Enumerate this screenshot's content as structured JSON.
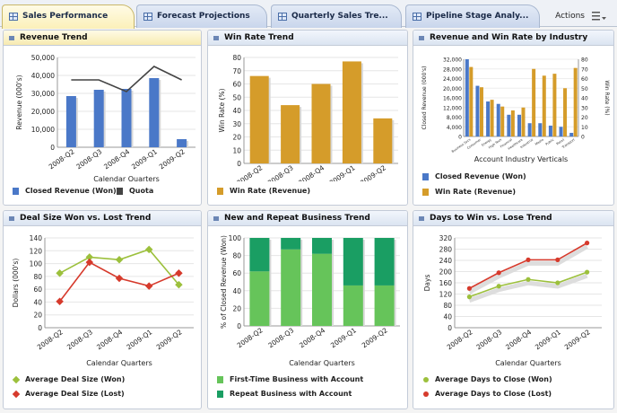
{
  "tabs": [
    {
      "label": "Sales Performance",
      "active": true
    },
    {
      "label": "Forecast Projections",
      "active": false
    },
    {
      "label": "Quarterly Sales Tre...",
      "active": false
    },
    {
      "label": "Pipeline Stage Analy...",
      "active": false
    }
  ],
  "toolbar": {
    "actions_label": "Actions"
  },
  "colors": {
    "blue": "#4a78c8",
    "gold": "#d59c2a",
    "dark": "#444444",
    "olive": "#9cc03c",
    "red": "#d63a2c",
    "green_light": "#66c45a",
    "green_dark": "#1a9e63"
  },
  "panels": {
    "revenue_trend": {
      "title": "Revenue Trend",
      "legend": [
        "Closed Revenue (Won)",
        "Quota"
      ],
      "chart_data": {
        "type": "bar",
        "categories": [
          "2008-Q2",
          "2008-Q3",
          "2008-Q4",
          "2009-Q1",
          "2009-Q2"
        ],
        "series": [
          {
            "name": "Closed Revenue (Won)",
            "values": [
              28500,
              32000,
              32500,
              38500,
              4500
            ],
            "kind": "bar"
          },
          {
            "name": "Quota",
            "values": [
              37500,
              37500,
              31000,
              45000,
              37500
            ],
            "kind": "line"
          }
        ],
        "ylim": [
          0,
          50000
        ],
        "yticks": [
          "0",
          "10,000",
          "20,000",
          "30,000",
          "40,000",
          "50,000"
        ],
        "ylabel": "Revenue (000's)",
        "xlabel": "Calendar Quarters"
      }
    },
    "win_rate_trend": {
      "title": "Win Rate Trend",
      "legend": [
        "Win Rate (Revenue)"
      ],
      "chart_data": {
        "type": "bar",
        "categories": [
          "2008-Q2",
          "2008-Q3",
          "2008-Q4",
          "2009-Q1",
          "2009-Q2"
        ],
        "series": [
          {
            "name": "Win Rate (Revenue)",
            "values": [
              66,
              44,
              60,
              77,
              34
            ]
          }
        ],
        "ylim": [
          0,
          80
        ],
        "yticks": [
          "0",
          "10",
          "20",
          "30",
          "40",
          "50",
          "60",
          "70",
          "80"
        ],
        "ylabel": "Win Rate (%)",
        "xlabel": "Calendar Quarters"
      }
    },
    "revenue_win_industry": {
      "title": "Revenue and Win Rate by Industry",
      "legend": [
        "Closed Revenue (Won)",
        "Win Rate (Revenue)"
      ],
      "chart_data": {
        "type": "bar",
        "categories": [
          "Business Svcs",
          "Consumer",
          "Energy",
          "High Tech",
          "Financial",
          "Healthcare",
          "Industrial",
          "Media",
          "Public",
          "Retail",
          "Transport"
        ],
        "series": [
          {
            "name": "Closed Revenue (Won)",
            "values": [
              32000,
              21000,
              14500,
              13500,
              9000,
              9000,
              5500,
              5500,
              4500,
              4000,
              1500
            ],
            "axis": "left"
          },
          {
            "name": "Win Rate (Revenue)",
            "values": [
              72,
              51,
              38,
              31,
              27,
              30,
              70,
              63,
              65,
              50,
              71
            ],
            "axis": "right"
          }
        ],
        "ylim_left": [
          0,
          32000
        ],
        "yticks_left": [
          "0",
          "4,000",
          "8,000",
          "12,000",
          "16,000",
          "20,000",
          "24,000",
          "28,000",
          "32,000"
        ],
        "ylim_right": [
          0,
          80
        ],
        "yticks_right": [
          "0",
          "10",
          "20",
          "30",
          "40",
          "50",
          "60",
          "70",
          "80"
        ],
        "ylabel_left": "Closed Revenue (000's)",
        "ylabel_right": "Win Rate (%)",
        "xlabel": "Account Industry Verticals"
      }
    },
    "deal_size": {
      "title": "Deal Size Won vs. Lost Trend",
      "legend": [
        "Average Deal Size (Won)",
        "Average Deal Size (Lost)"
      ],
      "chart_data": {
        "type": "line",
        "categories": [
          "2008-Q2",
          "2008-Q3",
          "2008-Q4",
          "2009-Q1",
          "2009-Q2"
        ],
        "series": [
          {
            "name": "Average Deal Size (Won)",
            "values": [
              85,
              110,
              106,
              122,
              67
            ]
          },
          {
            "name": "Average Deal Size (Lost)",
            "values": [
              41,
              102,
              77,
              65,
              85
            ]
          }
        ],
        "ylim": [
          0,
          140
        ],
        "yticks": [
          "0",
          "20",
          "40",
          "60",
          "80",
          "100",
          "120",
          "140"
        ],
        "ylabel": "Dollars (000's)",
        "xlabel": "Calendar Quarters"
      }
    },
    "new_repeat": {
      "title": "New and Repeat Business Trend",
      "legend": [
        "First-Time Business with Account",
        "Repeat Business with Account"
      ],
      "chart_data": {
        "type": "bar",
        "stacked": true,
        "categories": [
          "2008-Q2",
          "2008-Q3",
          "2008-Q4",
          "2009-Q1",
          "2009-Q2"
        ],
        "series": [
          {
            "name": "First-Time Business with Account",
            "values": [
              62,
              87,
              82,
              46,
              46
            ]
          },
          {
            "name": "Repeat Business with Account",
            "values": [
              38,
              13,
              18,
              54,
              54
            ]
          }
        ],
        "ylim": [
          0,
          100
        ],
        "yticks": [
          "0",
          "20",
          "40",
          "60",
          "80",
          "100"
        ],
        "ylabel": "% of Closed Revenue (Won)",
        "xlabel": "Calendar Quarters"
      }
    },
    "days_to_win": {
      "title": "Days to Win vs. Lose Trend",
      "legend": [
        "Average Days to Close (Won)",
        "Average Days to Close (Lost)"
      ],
      "chart_data": {
        "type": "line",
        "categories": [
          "2008-Q2",
          "2008-Q3",
          "2008-Q4",
          "2009-Q1",
          "2009-Q2"
        ],
        "series": [
          {
            "name": "Average Days to Close (Won)",
            "values": [
              110,
              148,
              172,
              160,
              198
            ]
          },
          {
            "name": "Average Days to Close (Lost)",
            "values": [
              140,
              196,
              242,
              242,
              302
            ]
          }
        ],
        "ylim": [
          0,
          320
        ],
        "yticks": [
          "0",
          "40",
          "80",
          "120",
          "160",
          "200",
          "240",
          "280",
          "320"
        ],
        "ylabel": "Days",
        "xlabel": "Calendar Quarters"
      }
    }
  }
}
